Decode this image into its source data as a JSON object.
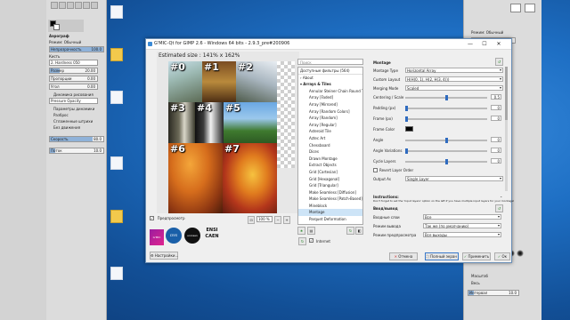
{
  "gimp_toolbox": {
    "tool_options_title": "Аэрограф",
    "mode_label": "Режим: Обычный",
    "opacity_label": "Непрозрачность",
    "opacity_value": "100.0",
    "brush_label": "Кисть",
    "brush_name": "2. Hardness 050",
    "size_label": "Размер",
    "size_value": "20.00",
    "ratio_label": "Пропорции",
    "ratio_value": "0.00",
    "angle_label": "Угол",
    "angle_value": "0.00",
    "dynamics_label": "Динамика рисования",
    "dynamics_name": "Pressure Opacity",
    "options": [
      "Параметры динамики",
      "Разброс",
      "Сглаженные штрихи",
      "Без движения"
    ],
    "rate_label": "Скорость",
    "rate_value": "80.0",
    "flow_label": "Поток",
    "flow_value": "10.0"
  },
  "gimp_dock": {
    "mode_label": "Режим: Обычный",
    "opacity_label": "Непрозрачность",
    "zoom_label": "Масштаб",
    "interval_label": "Интервал",
    "interval_value": "10.0",
    "spacing_label": "Весь"
  },
  "window": {
    "title": "G'MIC-Qt for GIMP 2.6 - Windows 64 bits - 2.9.3_pre#200906",
    "minimize": "—",
    "maximize": "☐",
    "close": "✕"
  },
  "preview": {
    "estimated_size": "Estimated size : 141% x 162%",
    "tiles": [
      "#0",
      "#1",
      "#2",
      "#3",
      "#4",
      "#5",
      "#6",
      "#7"
    ],
    "preview_checkbox_label": "Предпросмотр",
    "zoom_value": "100 %",
    "logos": [
      "G'MIC",
      "cnrs",
      "unicaen",
      "ENSI CAEN"
    ],
    "settings_button": "Настройки..."
  },
  "filters": {
    "search_placeholder": "Поиск",
    "header": "Доступные фильтры (564)",
    "items": [
      {
        "label": "About",
        "type": "cat"
      },
      {
        "label": "Arrays & Tiles",
        "type": "cat-open"
      },
      {
        "label": "Annular Steiner Chain Round Tile"
      },
      {
        "label": "Array [Faded]"
      },
      {
        "label": "Array [Mirrored]"
      },
      {
        "label": "Array [Random Colors]"
      },
      {
        "label": "Array [Random]"
      },
      {
        "label": "Array [Regular]"
      },
      {
        "label": "Asteroid Tile"
      },
      {
        "label": "Aztec Art"
      },
      {
        "label": "Chessboard"
      },
      {
        "label": "Dices"
      },
      {
        "label": "Drawn Montage"
      },
      {
        "label": "Extract Objects"
      },
      {
        "label": "Grid [Cartesian]"
      },
      {
        "label": "Grid [Hexagonal]"
      },
      {
        "label": "Grid [Triangular]"
      },
      {
        "label": "Make Seamless [Diffusion]"
      },
      {
        "label": "Make Seamless [Patch-Based]"
      },
      {
        "label": "Mineblock"
      },
      {
        "label": "Montage",
        "selected": true
      },
      {
        "label": "Parquet Deformation"
      },
      {
        "label": "Puzzle"
      },
      {
        "label": "Taquin"
      },
      {
        "label": "Tileable Rotation"
      },
      {
        "label": "Tiled Isolation"
      }
    ],
    "internet_label": "Internet"
  },
  "params": {
    "title": "Montage",
    "rows": [
      {
        "label": "Montage Type",
        "kind": "select",
        "value": "Horizontal Array"
      },
      {
        "label": "Custom Layout",
        "kind": "text",
        "value": "H(H(0, 1), H(2, H(3, 4)))"
      },
      {
        "label": "Merging Mode",
        "kind": "select",
        "value": "Scaled"
      },
      {
        "label": "Centering / Scale",
        "kind": "slider",
        "value": "0.5",
        "pos": 0.5
      },
      {
        "label": "Padding (px)",
        "kind": "slider",
        "value": "0",
        "pos": 0
      },
      {
        "label": "Frame (px)",
        "kind": "slider",
        "value": "0",
        "pos": 0
      },
      {
        "label": "Frame Color",
        "kind": "color",
        "value": ""
      },
      {
        "label": "Angle",
        "kind": "slider",
        "value": "0",
        "pos": 0.5
      },
      {
        "label": "Angle Variations",
        "kind": "slider",
        "value": "0",
        "pos": 0
      },
      {
        "label": "Cycle Layers",
        "kind": "slider",
        "value": "0",
        "pos": 0.5
      },
      {
        "label": "Revert Layer Order",
        "kind": "check",
        "value": ""
      },
      {
        "label": "Output As",
        "kind": "select",
        "value": "Single Layer"
      }
    ],
    "instructions_label": "Instructions:",
    "instructions_text": "Don't forget to set the 'Input layers' option on the left if you have multiple input layers for your montage!"
  },
  "io": {
    "title": "Ввод/вывод",
    "rows": [
      {
        "label": "Входные слои",
        "value": "Все"
      },
      {
        "label": "Режим вывода",
        "value": "Так же (по умолчанию)"
      },
      {
        "label": "Режим предпросмотра",
        "value": "Все выходы"
      }
    ]
  },
  "buttons": {
    "cancel": "Отмена",
    "fullscreen": "Полный экран",
    "apply": "Применить",
    "ok": "Ок"
  },
  "colors": {
    "accent": "#2f6bbf",
    "window_border": "#6a8fb7",
    "desktop": "#1e6fc4"
  }
}
